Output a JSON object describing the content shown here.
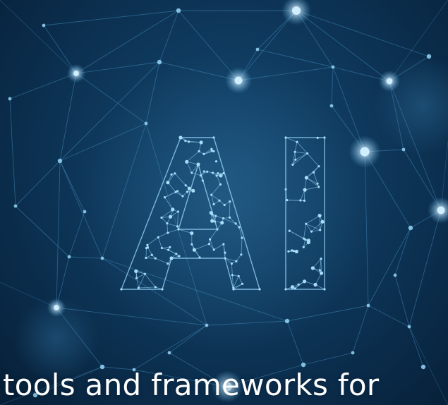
{
  "graphic": {
    "glyphs": "AI",
    "background_color": "#0b2d4b",
    "line_color": "#3f86b6",
    "node_color": "#9fd4f2",
    "glow_color": "#cfeeff"
  },
  "caption": {
    "text": "tools and frameworks for"
  }
}
